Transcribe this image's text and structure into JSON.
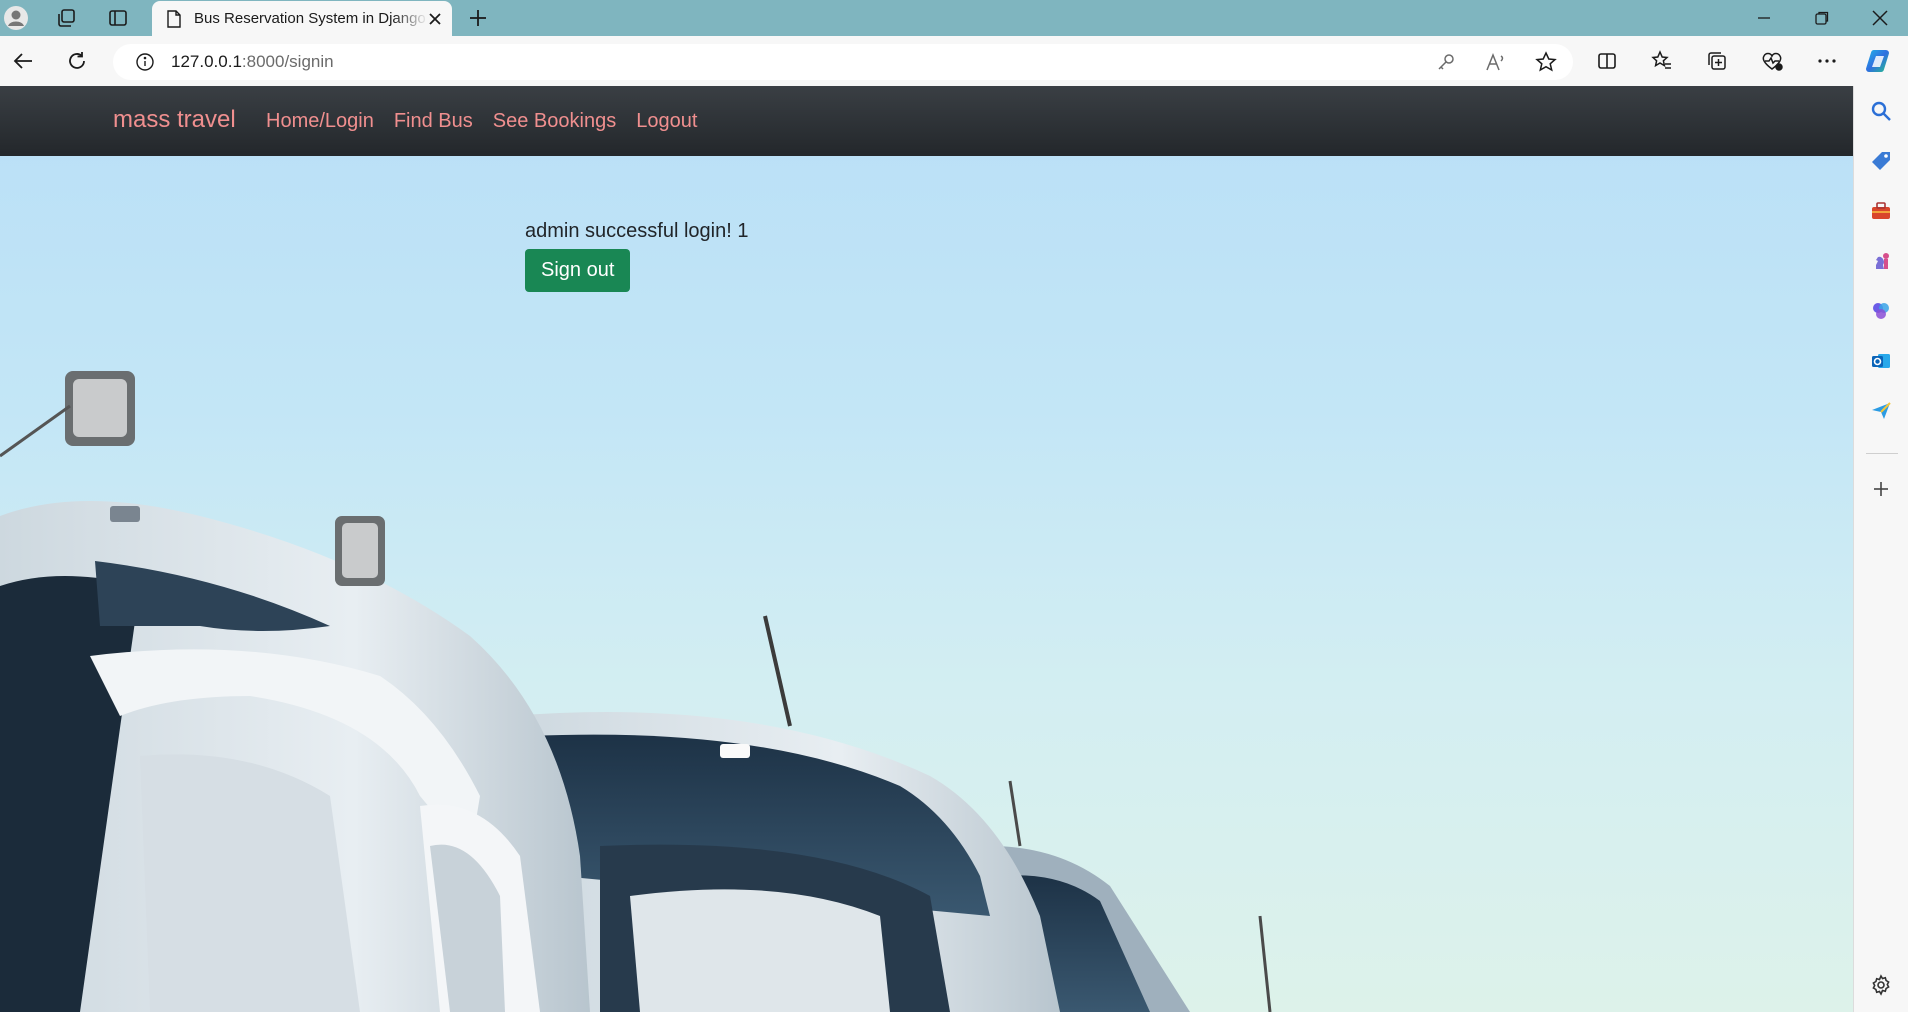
{
  "browser": {
    "tab_title": "Bus Reservation System in Django",
    "url_host": "127.0.0.1",
    "url_path": ":8000/signin"
  },
  "navbar": {
    "brand": "mass travel",
    "links": [
      "Home/Login",
      "Find Bus",
      "See Bookings",
      "Logout"
    ]
  },
  "main": {
    "message": "admin successful login! 1",
    "signout_label": "Sign out"
  },
  "colors": {
    "nav_link": "#f08f8f",
    "navbar_bg": "#2c3035",
    "signout_bg": "#198754",
    "sky": "#c3e6f6"
  },
  "icons": {
    "sidebar": [
      "search-icon",
      "tag-icon",
      "toolbox-icon",
      "chess-icon",
      "copilot-icon",
      "outlook-icon",
      "send-icon",
      "add-icon",
      "settings-icon"
    ]
  }
}
